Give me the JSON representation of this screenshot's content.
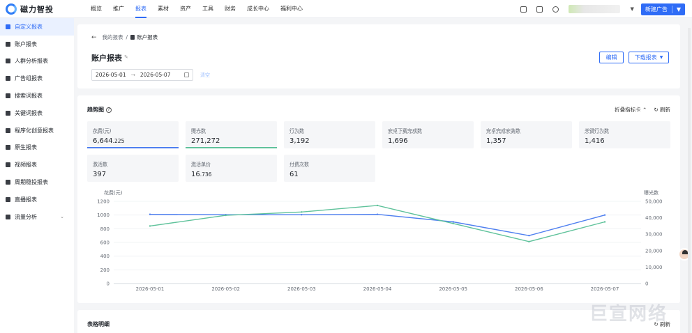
{
  "brand": {
    "name": "磁力智投",
    "accent": "#2f6cf6"
  },
  "nav": {
    "items": [
      "概览",
      "推广",
      "报表",
      "素材",
      "资产",
      "工具",
      "财务",
      "成长中心",
      "福利中心"
    ],
    "active_index": 2,
    "new_button": "新建广告"
  },
  "sidebar": {
    "items": [
      {
        "label": "自定义报表",
        "icon": "report-icon"
      },
      {
        "label": "账户报表",
        "icon": "user-icon"
      },
      {
        "label": "人群分析报表",
        "icon": "crowd-icon"
      },
      {
        "label": "广告组报表",
        "icon": "folder-icon"
      },
      {
        "label": "搜索词报表",
        "icon": "search-report-icon"
      },
      {
        "label": "关键词报表",
        "icon": "keyword-icon"
      },
      {
        "label": "程序化创意报表",
        "icon": "creative-icon"
      },
      {
        "label": "原生报表",
        "icon": "native-icon"
      },
      {
        "label": "视频报表",
        "icon": "video-icon"
      },
      {
        "label": "周期稳投报表",
        "icon": "cycle-icon"
      },
      {
        "label": "直播报表",
        "icon": "live-icon"
      },
      {
        "label": "流量分析",
        "icon": "traffic-icon"
      }
    ],
    "active_index": 0
  },
  "header": {
    "breadcrumb_root": "我的报表",
    "breadcrumb_sep": "/",
    "breadcrumb_current": "账户报表",
    "title": "账户报表",
    "date_start": "2026-05-01",
    "date_end": "2026-05-07",
    "clear_label": "清空",
    "edit_button": "编辑",
    "download_button": "下载报表"
  },
  "trend": {
    "title": "趋势图",
    "collapse_label": "折叠指标卡",
    "refresh_label": "刷新",
    "metrics": [
      {
        "label": "花费(元)",
        "value": "6,644",
        "decimals": ".225",
        "color": "#4e7ff0"
      },
      {
        "label": "曝光数",
        "value": "271,272",
        "decimals": "",
        "color": "#5fc29b"
      },
      {
        "label": "行为数",
        "value": "3,192",
        "decimals": "",
        "color": ""
      },
      {
        "label": "安卓下载完成数",
        "value": "1,696",
        "decimals": "",
        "color": ""
      },
      {
        "label": "安卓完成安装数",
        "value": "1,357",
        "decimals": "",
        "color": ""
      },
      {
        "label": "关键行为数",
        "value": "1,416",
        "decimals": "",
        "color": ""
      },
      {
        "label": "激活数",
        "value": "397",
        "decimals": "",
        "color": ""
      },
      {
        "label": "激活单价",
        "value": "16",
        "decimals": ".736",
        "color": ""
      },
      {
        "label": "付费次数",
        "value": "61",
        "decimals": "",
        "color": ""
      }
    ]
  },
  "detail": {
    "title": "表格明细",
    "refresh_label": "刷新"
  },
  "watermark_text": "巨宣网络",
  "chart_data": {
    "type": "line",
    "x": [
      "2026-05-01",
      "2026-05-02",
      "2026-05-03",
      "2026-05-04",
      "2026-05-05",
      "2026-05-06",
      "2026-05-07"
    ],
    "series": [
      {
        "name": "花费(元)",
        "axis": "left",
        "color": "#4e7ff0",
        "values": [
          1010,
          1005,
          1005,
          1010,
          900,
          700,
          1000
        ]
      },
      {
        "name": "曝光数",
        "axis": "right",
        "color": "#5fc29b",
        "values": [
          35000,
          41500,
          43500,
          47500,
          36500,
          25500,
          37500
        ]
      }
    ],
    "ylabel_left": "花费(元)",
    "ylabel_right": "曝光数",
    "yticks_left": [
      0,
      200,
      400,
      600,
      800,
      1000,
      1200
    ],
    "yticks_right": [
      0,
      10000,
      20000,
      30000,
      40000,
      50000
    ],
    "ylim_left": [
      0,
      1200
    ],
    "ylim_right": [
      0,
      50000
    ],
    "grid": true
  }
}
